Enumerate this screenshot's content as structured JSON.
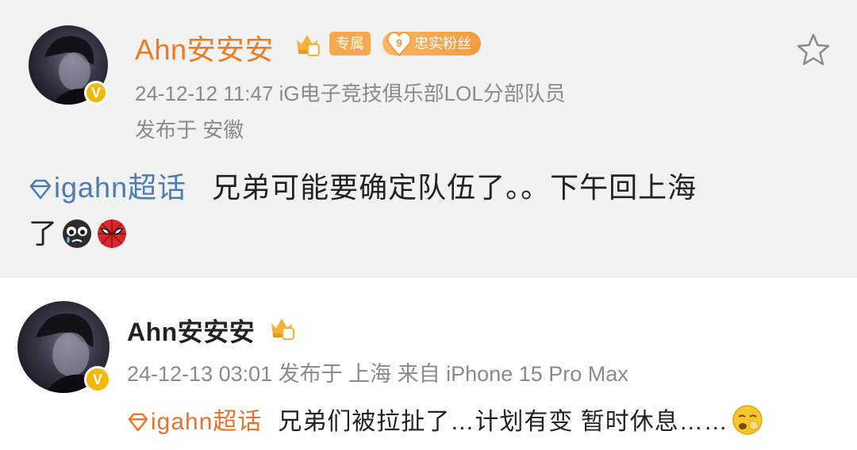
{
  "posts": [
    {
      "user_name": "Ahn安安安",
      "badges": {
        "exclusive": "专属",
        "fan_level": "9",
        "fan_label": "忠实粉丝"
      },
      "meta_line1": "24-12-12 11:47   iG电子竞技俱乐部LOL分部队员",
      "meta_line2": "发布于 安徽",
      "topic": "igahn超话",
      "text_line1": "兄弟可能要确定队伍了。。下午回上海",
      "text_line2": "了",
      "emojis": [
        "crying-face-emoji",
        "spider-man-emoji"
      ]
    },
    {
      "user_name": "Ahn安安安",
      "meta_line1": "24-12-13 03:01 发布于 上海 来自 iPhone 15 Pro Max",
      "topic": "igahn超话",
      "text": "兄弟们被拉扯了…计划有变 暂时休息……",
      "emojis": [
        "yawning-face-emoji"
      ]
    }
  ],
  "colors": {
    "name_orange": "#f07b1e",
    "topic_blue": "#4d7bb5",
    "topic_orange": "#e8732a",
    "meta_gray": "#8a8a8a",
    "verified_gold": "#f5b800"
  }
}
